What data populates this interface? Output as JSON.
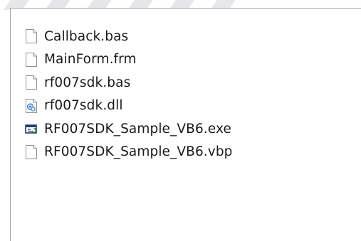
{
  "files": [
    {
      "name": "Callback.bas",
      "icon": "blank-document-icon"
    },
    {
      "name": "MainForm.frm",
      "icon": "blank-document-icon"
    },
    {
      "name": "rf007sdk.bas",
      "icon": "blank-document-icon"
    },
    {
      "name": "rf007sdk.dll",
      "icon": "dll-gear-document-icon"
    },
    {
      "name": "RF007SDK_Sample_VB6.exe",
      "icon": "application-window-icon"
    },
    {
      "name": "RF007SDK_Sample_VB6.vbp",
      "icon": "blank-document-icon"
    }
  ],
  "colors": {
    "text": "#1a1a1a",
    "frame_border": "#a3a3a3",
    "icon_outline": "#8f8f8f",
    "dll_accent": "#3a78c8",
    "exe_accent": "#1f3f6e"
  }
}
